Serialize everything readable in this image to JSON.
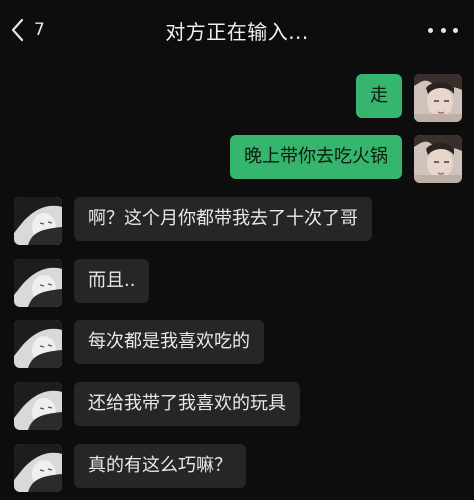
{
  "header": {
    "unread_count": "7",
    "title": "对方正在输入..."
  },
  "messages": [
    {
      "side": "out",
      "text": "走"
    },
    {
      "side": "out",
      "text": "晚上带你去吃火锅"
    },
    {
      "side": "in",
      "text": "啊？这个月你都带我去了十次了哥"
    },
    {
      "side": "in",
      "text": "而且.."
    },
    {
      "side": "in",
      "text": "每次都是我喜欢吃的"
    },
    {
      "side": "in",
      "text": "还给我带了我喜欢的玩具"
    },
    {
      "side": "in",
      "text": "真的有这么巧嘛？"
    }
  ],
  "icons": {
    "back": "chevron-left-icon",
    "more": "more-dots-icon"
  },
  "colors": {
    "background": "#0d0d0d",
    "outgoing_bubble": "#36b56e",
    "incoming_bubble": "#262626"
  }
}
